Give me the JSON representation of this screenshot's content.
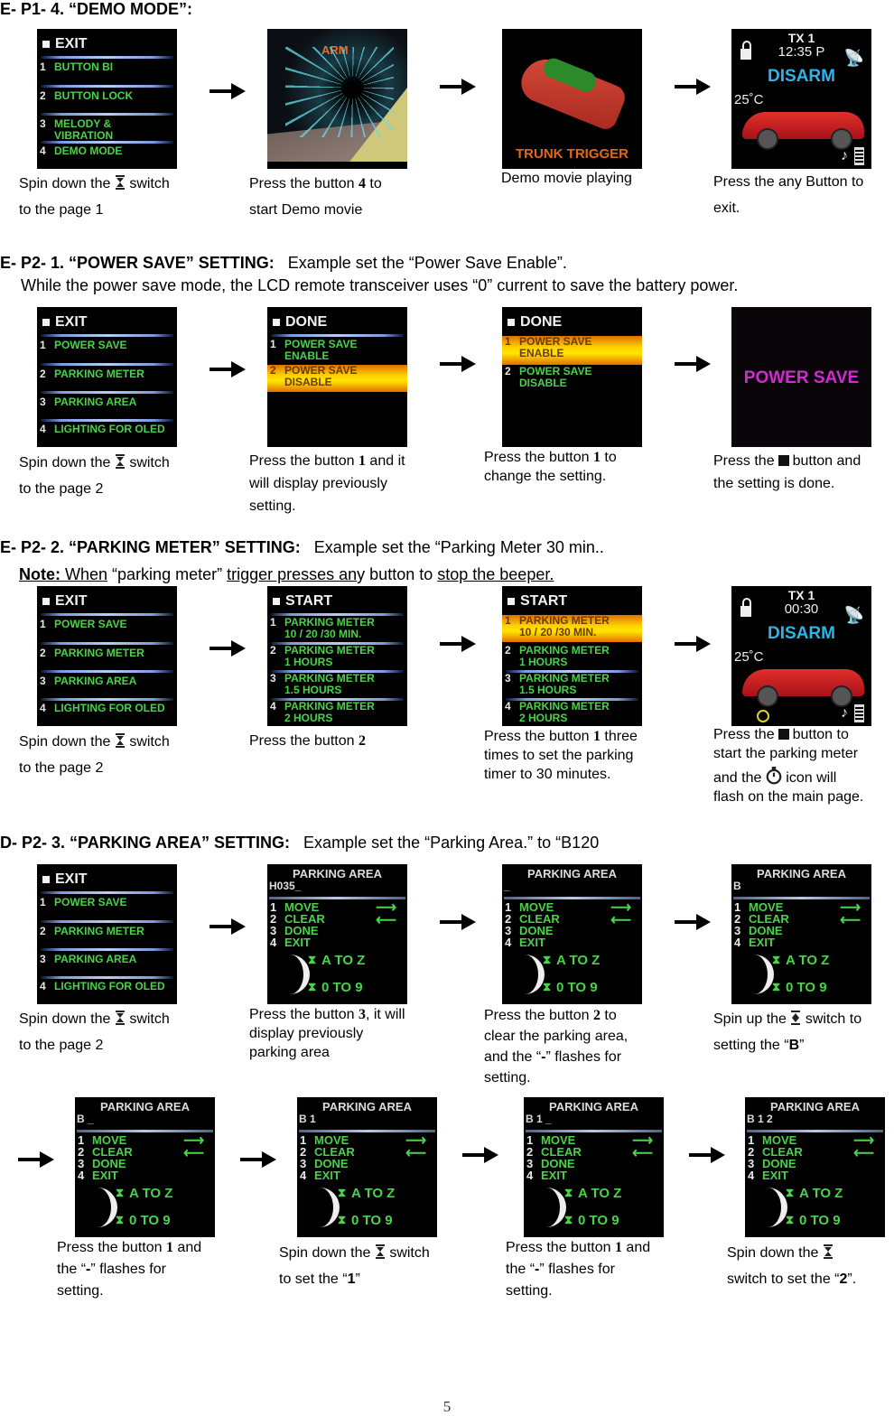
{
  "sections": {
    "demo": {
      "heading": "E- P1- 4. “DEMO MODE”:",
      "menu_screen": {
        "header": "EXIT",
        "items": [
          {
            "num": "1",
            "label": "BUTTON BI"
          },
          {
            "num": "2",
            "label": "BUTTON LOCK"
          },
          {
            "num": "3",
            "label": "MELODY & VIBRATION"
          },
          {
            "num": "4",
            "label": "DEMO MODE"
          }
        ]
      },
      "arm_screen": {
        "text": "ARM"
      },
      "trunk_screen": {
        "text": "TRUNK TRIGGER"
      },
      "status_screen": {
        "tx": "TX 1",
        "time": "12:35 P",
        "state": "DISARM",
        "temp": "25˚C"
      },
      "captions": [
        {
          "pre": "Spin down the",
          "post": "switch",
          "line2": "to the page 1"
        },
        {
          "pre": "Press the button",
          "btn": "4",
          "post": "to",
          "line2": "start Demo movie"
        },
        {
          "text": "Demo movie playing"
        },
        {
          "line1": "Press the any Button to",
          "line2": "exit."
        }
      ]
    },
    "power_save": {
      "heading": "E- P2- 1. “POWER SAVE” SETTING:",
      "heading_example": "Example set the “Power Save Enable”.",
      "description": "While the power save mode, the LCD remote transceiver uses “0” current to save the battery power.",
      "menu_screen": {
        "header": "EXIT",
        "items": [
          {
            "num": "1",
            "label": "POWER SAVE"
          },
          {
            "num": "2",
            "label": "PARKING METER"
          },
          {
            "num": "3",
            "label": "PARKING AREA"
          },
          {
            "num": "4",
            "label": "LIGHTING FOR OLED"
          }
        ]
      },
      "option_screen": {
        "header": "DONE",
        "items": [
          {
            "num": "1",
            "label": "POWER SAVE ENABLE"
          },
          {
            "num": "2",
            "label": "POWER SAVE DISABLE"
          }
        ]
      },
      "final_screen": {
        "text": "POWER SAVE"
      },
      "captions": [
        {
          "pre": "Spin down the",
          "post": "switch",
          "line2": "to the page 2"
        },
        {
          "pre": "Press the button",
          "btn": "1",
          "post": "and it",
          "line2": "will display previously",
          "line3": "setting."
        },
        {
          "pre": "Press the button",
          "btn": "1",
          "post": "to",
          "line2": "change the setting."
        },
        {
          "pre": "Press the",
          "post": "button and",
          "line2": "the setting is done."
        }
      ]
    },
    "parking_meter": {
      "heading": "E- P2- 2. “PARKING METER” SETTING:",
      "heading_example": "Example set the “Parking Meter 30 min..",
      "note_label": "Note:",
      "note_parts": [
        "When",
        " “parking meter” ",
        "trigger presses an",
        "y button to ",
        "stop the beeper."
      ],
      "menu_screen": {
        "header": "EXIT",
        "items": [
          {
            "num": "1",
            "label": "POWER SAVE"
          },
          {
            "num": "2",
            "label": "PARKING METER"
          },
          {
            "num": "3",
            "label": "PARKING AREA"
          },
          {
            "num": "4",
            "label": "LIGHTING FOR OLED"
          }
        ]
      },
      "option_screen": {
        "header": "START",
        "items": [
          {
            "num": "1",
            "label": "PARKING METER",
            "sub": "10 / 20 /30 MIN."
          },
          {
            "num": "2",
            "label": "PARKING METER",
            "sub": "1 HOURS"
          },
          {
            "num": "3",
            "label": "PARKING METER",
            "sub": "1.5 HOURS"
          },
          {
            "num": "4",
            "label": "PARKING METER",
            "sub": "2 HOURS"
          }
        ]
      },
      "status_screen": {
        "tx": "TX 1",
        "time": "00:30",
        "state": "DISARM",
        "temp": "25˚C"
      },
      "captions": [
        {
          "pre": "Spin down the",
          "post": "switch",
          "line2": "to the page 2"
        },
        {
          "pre": "Press the button",
          "btn": "2"
        },
        {
          "pre": "Press the button",
          "btn": "1",
          "post": "three",
          "line2": "times to set the parking",
          "line3": "timer to 30 minutes."
        },
        {
          "pre": "Press the",
          "post": "button to",
          "line2": "start the parking meter",
          "line3_pre": "and the",
          "line3_post": "icon will",
          "line4": "flash on the main page."
        }
      ]
    },
    "parking_area": {
      "heading": "D- P2- 3. “PARKING AREA” SETTING:",
      "heading_example": "Example set the “Parking Area.” to “B120",
      "menu_screen": {
        "header": "EXIT",
        "items": [
          {
            "num": "1",
            "label": "POWER SAVE"
          },
          {
            "num": "2",
            "label": "PARKING METER"
          },
          {
            "num": "3",
            "label": "PARKING AREA"
          },
          {
            "num": "4",
            "label": "LIGHTING FOR OLED"
          }
        ]
      },
      "area_screen": {
        "title": "PARKING AREA",
        "menu": [
          {
            "num": "1",
            "label": "MOVE"
          },
          {
            "num": "2",
            "label": "CLEAR"
          },
          {
            "num": "3",
            "label": "DONE"
          },
          {
            "num": "4",
            "label": "EXIT"
          }
        ],
        "az": "A TO Z",
        "nine": "0 TO 9"
      },
      "codes": [
        "H035_",
        "_",
        "B",
        "B _",
        "B 1",
        "B 1 _",
        "B 1 2"
      ],
      "captions_row1": [
        {
          "pre": "Spin down the",
          "post": "switch",
          "line2": "to the page 2"
        },
        {
          "pre": "Press the button",
          "btn": "3",
          "post": ", it will",
          "line2": "display previously",
          "line3": "parking area"
        },
        {
          "pre": "Press the button",
          "btn": "2",
          "post": "to",
          "line2": "clear the parking area,",
          "line3_pre": "and the “",
          "line3_bold": "-",
          "line3_post": "” flashes for",
          "line4": "setting."
        },
        {
          "pre": "Spin up the",
          "post": "switch to",
          "line2_pre": "setting the “",
          "line2_bold": "B",
          "line2_post": "”"
        }
      ],
      "captions_row2": [
        {
          "pre": "Press the button",
          "btn": "1",
          "post": "and",
          "line2_pre": "the “",
          "line2_bold": "-",
          "line2_post": "” flashes for",
          "line3": "setting."
        },
        {
          "pre": "Spin down the",
          "post": "switch",
          "line2_pre": "to set the “",
          "line2_bold": "1",
          "line2_post": "”"
        },
        {
          "pre": "Press the button",
          "btn": "1",
          "post": "and",
          "line2_pre": "the “",
          "line2_bold": "-",
          "line2_post": "” flashes for",
          "line3": "setting."
        },
        {
          "pre": "Spin down the",
          "line2_pre": "switch to set the “",
          "line2_bold": "2",
          "line2_post": "”."
        }
      ]
    }
  },
  "page_number": "5",
  "colors": {
    "menu_green": "#49d24a",
    "disarm_blue": "#2db4e8",
    "power_save_magenta": "#d22ad4",
    "highlight_yellow": "#ffd200"
  }
}
